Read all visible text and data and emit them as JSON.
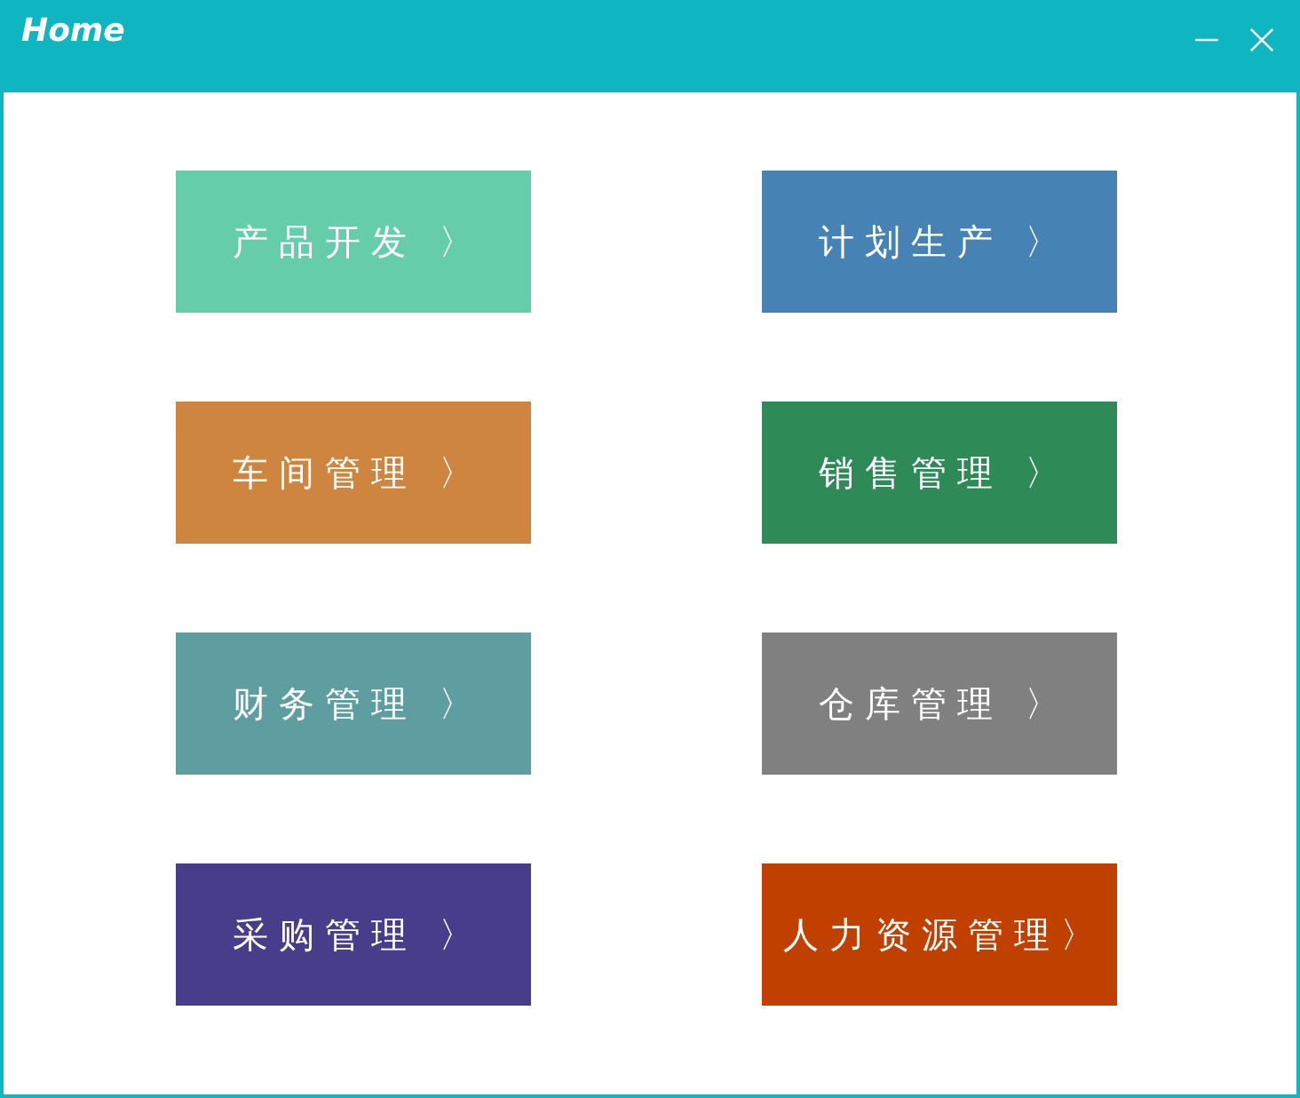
{
  "window": {
    "title": "Home"
  },
  "tiles": [
    {
      "label": "产品开发 〉",
      "color": "#66cdaa"
    },
    {
      "label": "计划生产 〉",
      "color": "#4682b4"
    },
    {
      "label": "车间管理 〉",
      "color": "#cd853f"
    },
    {
      "label": "销售管理 〉",
      "color": "#2e8b57"
    },
    {
      "label": "财务管理 〉",
      "color": "#5f9ea0"
    },
    {
      "label": "仓库管理 〉",
      "color": "#808080"
    },
    {
      "label": "采购管理 〉",
      "color": "#483d8b"
    },
    {
      "label": "人力资源管理〉",
      "color": "#c04000"
    }
  ]
}
